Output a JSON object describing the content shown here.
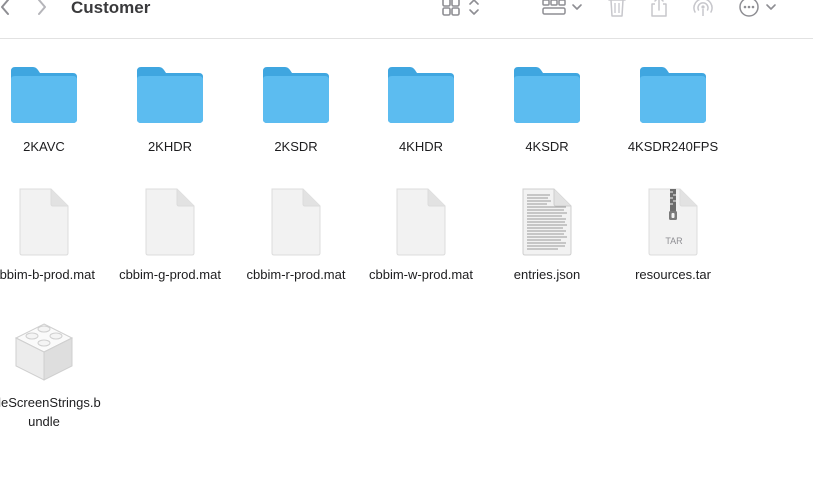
{
  "window": {
    "title": "Customer"
  },
  "toolbar": {
    "back": "chevron-left",
    "forward": "chevron-right",
    "view": "icon-grid",
    "group": "group-by-grid",
    "delete": "trash",
    "share": "share",
    "airdrop": "airdrop",
    "more": "ellipsis-circle"
  },
  "colors": {
    "folder": "#5cbcf0",
    "folder_tab": "#3fa6e0",
    "document": "#f2f2f2"
  },
  "files": [
    {
      "name": "2KAVC",
      "kind": "folder"
    },
    {
      "name": "2KHDR",
      "kind": "folder"
    },
    {
      "name": "2KSDR",
      "kind": "folder"
    },
    {
      "name": "4KHDR",
      "kind": "folder"
    },
    {
      "name": "4KSDR",
      "kind": "folder"
    },
    {
      "name": "4KSDR240FPS",
      "kind": "folder"
    },
    {
      "name": "cbbim-b-prod.mat",
      "kind": "document"
    },
    {
      "name": "cbbim-g-prod.mat",
      "kind": "document"
    },
    {
      "name": "cbbim-r-prod.mat",
      "kind": "document"
    },
    {
      "name": "cbbim-w-prod.mat",
      "kind": "document"
    },
    {
      "name": "entries.json",
      "kind": "text-document"
    },
    {
      "name": "resources.tar",
      "kind": "archive",
      "badge": "TAR"
    },
    {
      "name": "IdleScreenStrings.bundle",
      "kind": "bundle"
    }
  ]
}
